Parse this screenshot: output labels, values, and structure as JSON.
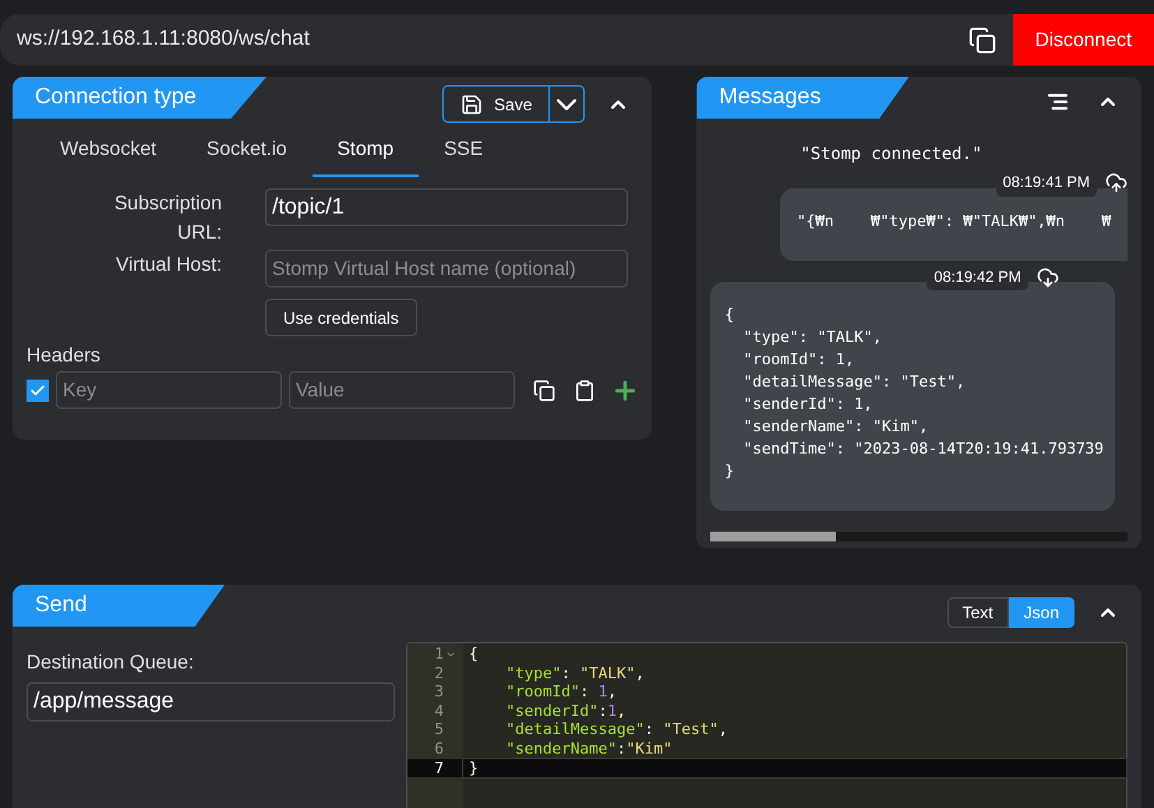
{
  "url_bar": {
    "value": "ws://192.168.1.11:8080/ws/chat",
    "disconnect": "Disconnect"
  },
  "connection": {
    "title": "Connection type",
    "save": "Save",
    "tabs": [
      {
        "label": "Websocket",
        "selected": false
      },
      {
        "label": "Socket.io",
        "selected": false
      },
      {
        "label": "Stomp",
        "selected": true
      },
      {
        "label": "SSE",
        "selected": false
      }
    ],
    "subscription_label": "Subscription URL:",
    "subscription_value": "/topic/1",
    "vhost_label": "Virtual Host:",
    "vhost_placeholder": "Stomp Virtual Host name (optional)",
    "credentials": "Use credentials",
    "headers_label": "Headers",
    "header_row": {
      "checked": true,
      "key_placeholder": "Key",
      "value_placeholder": "Value"
    }
  },
  "messages": {
    "title": "Messages",
    "items": [
      {
        "kind": "system",
        "text": "\"Stomp connected.\""
      },
      {
        "kind": "sent",
        "time": "08:19:41 PM",
        "text": "\"{₩n    ₩\"type₩\": ₩\"TALK₩\",₩n    ₩"
      },
      {
        "kind": "received",
        "time": "08:19:42 PM",
        "text": "{\n  \"type\": \"TALK\",\n  \"roomId\": 1,\n  \"detailMessage\": \"Test\",\n  \"senderId\": 1,\n  \"senderName\": \"Kim\",\n  \"sendTime\": \"2023-08-14T20:19:41.793739\n}"
      }
    ]
  },
  "send": {
    "title": "Send",
    "formats": [
      {
        "label": "Text",
        "selected": false
      },
      {
        "label": "Json",
        "selected": true
      }
    ],
    "destination_label": "Destination Queue:",
    "destination_value": "/app/message",
    "editor_lines": [
      {
        "number": "1",
        "active": false,
        "foldable": true,
        "tokens": [
          {
            "kind": "punct",
            "text": "{"
          }
        ]
      },
      {
        "number": "2",
        "active": false,
        "foldable": false,
        "tokens": [
          {
            "kind": "key",
            "text": "    \"type\""
          },
          {
            "kind": "punct",
            "text": ": "
          },
          {
            "kind": "string",
            "text": "\"TALK\""
          },
          {
            "kind": "punct",
            "text": ","
          }
        ]
      },
      {
        "number": "3",
        "active": false,
        "foldable": false,
        "tokens": [
          {
            "kind": "key",
            "text": "    \"roomId\""
          },
          {
            "kind": "punct",
            "text": ": "
          },
          {
            "kind": "number",
            "text": "1"
          },
          {
            "kind": "punct",
            "text": ","
          }
        ]
      },
      {
        "number": "4",
        "active": false,
        "foldable": false,
        "tokens": [
          {
            "kind": "key",
            "text": "    \"senderId\""
          },
          {
            "kind": "punct",
            "text": ":"
          },
          {
            "kind": "number",
            "text": "1"
          },
          {
            "kind": "punct",
            "text": ","
          }
        ]
      },
      {
        "number": "5",
        "active": false,
        "foldable": false,
        "tokens": [
          {
            "kind": "key",
            "text": "    \"detailMessage\""
          },
          {
            "kind": "punct",
            "text": ": "
          },
          {
            "kind": "string",
            "text": "\"Test\""
          },
          {
            "kind": "punct",
            "text": ","
          }
        ]
      },
      {
        "number": "6",
        "active": false,
        "foldable": false,
        "tokens": [
          {
            "kind": "key",
            "text": "    \"senderName\""
          },
          {
            "kind": "punct",
            "text": ":"
          },
          {
            "kind": "string",
            "text": "\"Kim\""
          }
        ]
      },
      {
        "number": "7",
        "active": true,
        "foldable": false,
        "tokens": [
          {
            "kind": "punct",
            "text": "}"
          }
        ]
      }
    ]
  }
}
